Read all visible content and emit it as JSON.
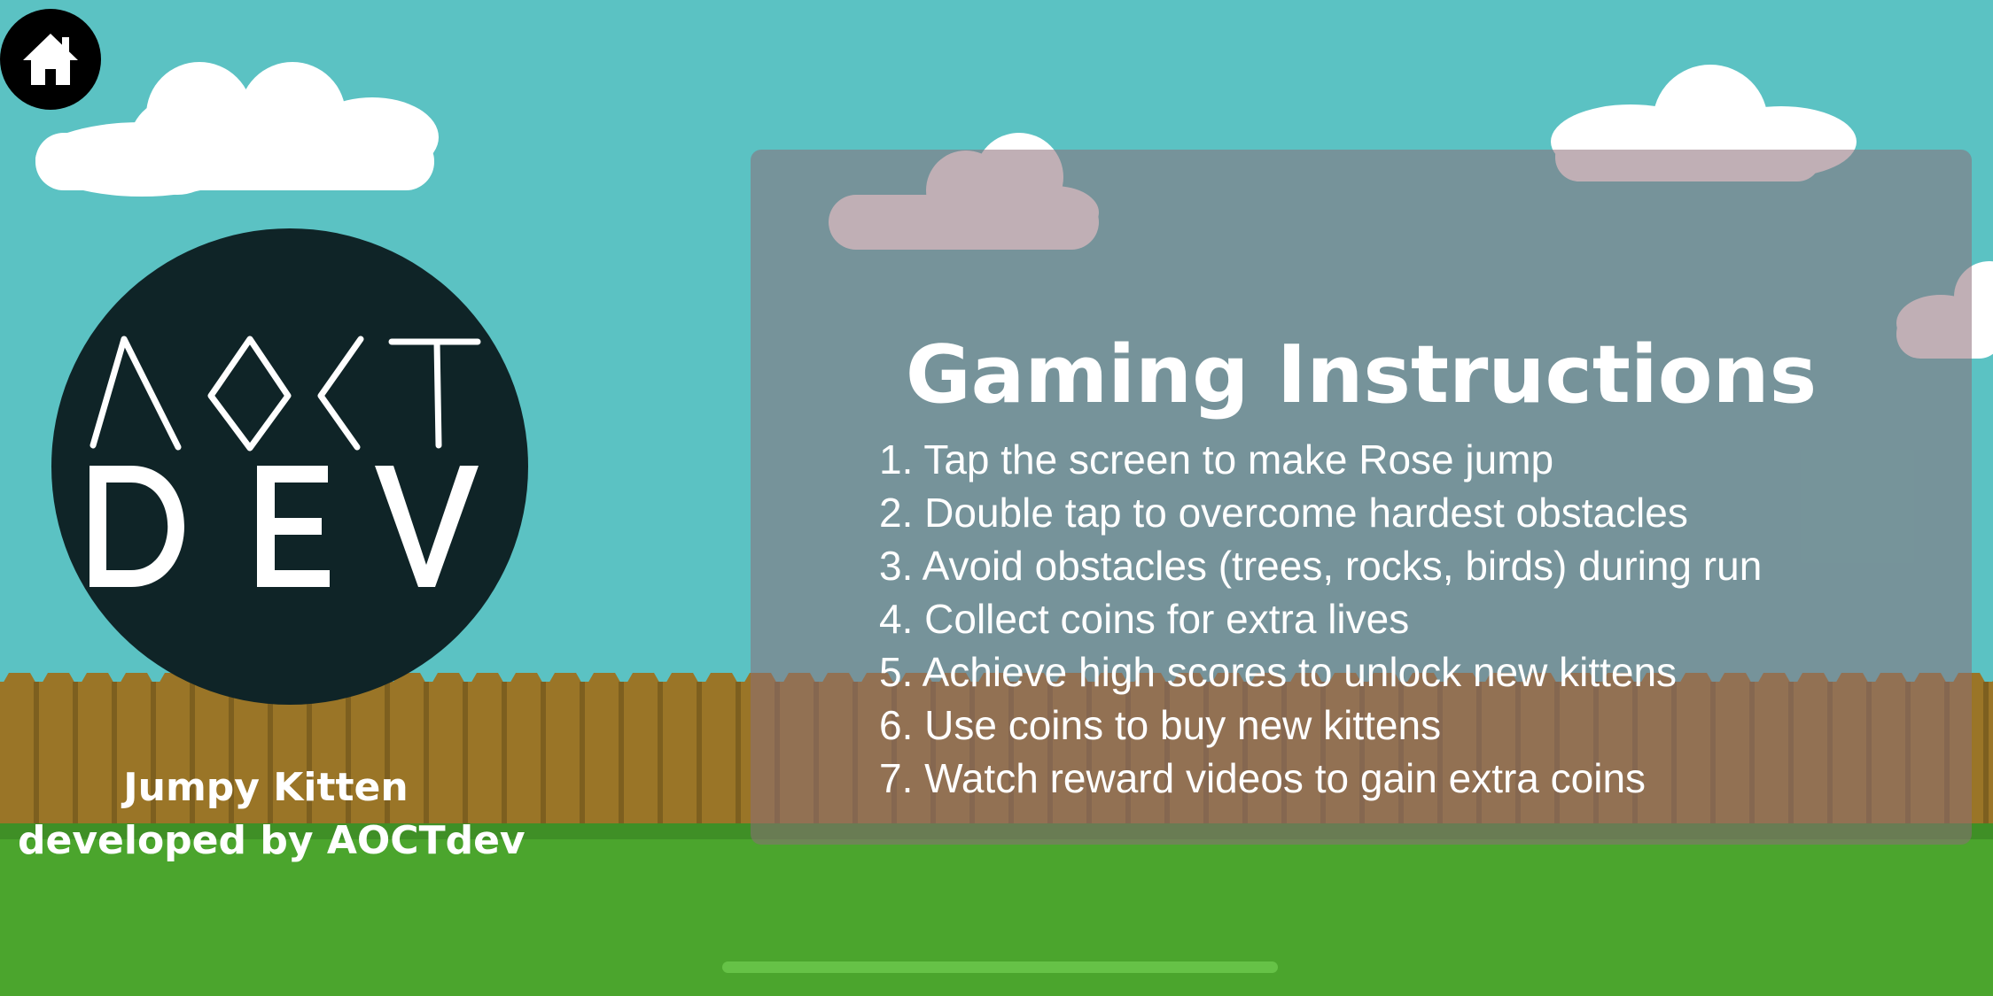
{
  "colors": {
    "sky": "#5bc2c3",
    "cloud": "#ffffff",
    "fence": "#9a7527",
    "fence_shadow": "#7d5f1f",
    "grass": "#4ba52d",
    "logo_bg": "#0f2427",
    "panel": "rgba(140,110,120,0.55)",
    "text": "#ffffff"
  },
  "home_button": {
    "icon": "home-icon"
  },
  "logo": {
    "top_text": "AOCT",
    "bottom_text": "DEV"
  },
  "credits": {
    "line1": "Jumpy Kitten",
    "line2": "developed by AOCTdev"
  },
  "instructions": {
    "title": "Gaming Instructions",
    "items": [
      "1. Tap the screen to make Rose jump",
      "2. Double tap to overcome hardest obstacles",
      "3. Avoid obstacles (trees, rocks, birds) during run",
      "4. Collect coins for extra lives",
      "5. Achieve high scores to unlock new kittens",
      "6. Use coins to buy new kittens",
      "7. Watch reward videos to gain extra coins"
    ]
  }
}
